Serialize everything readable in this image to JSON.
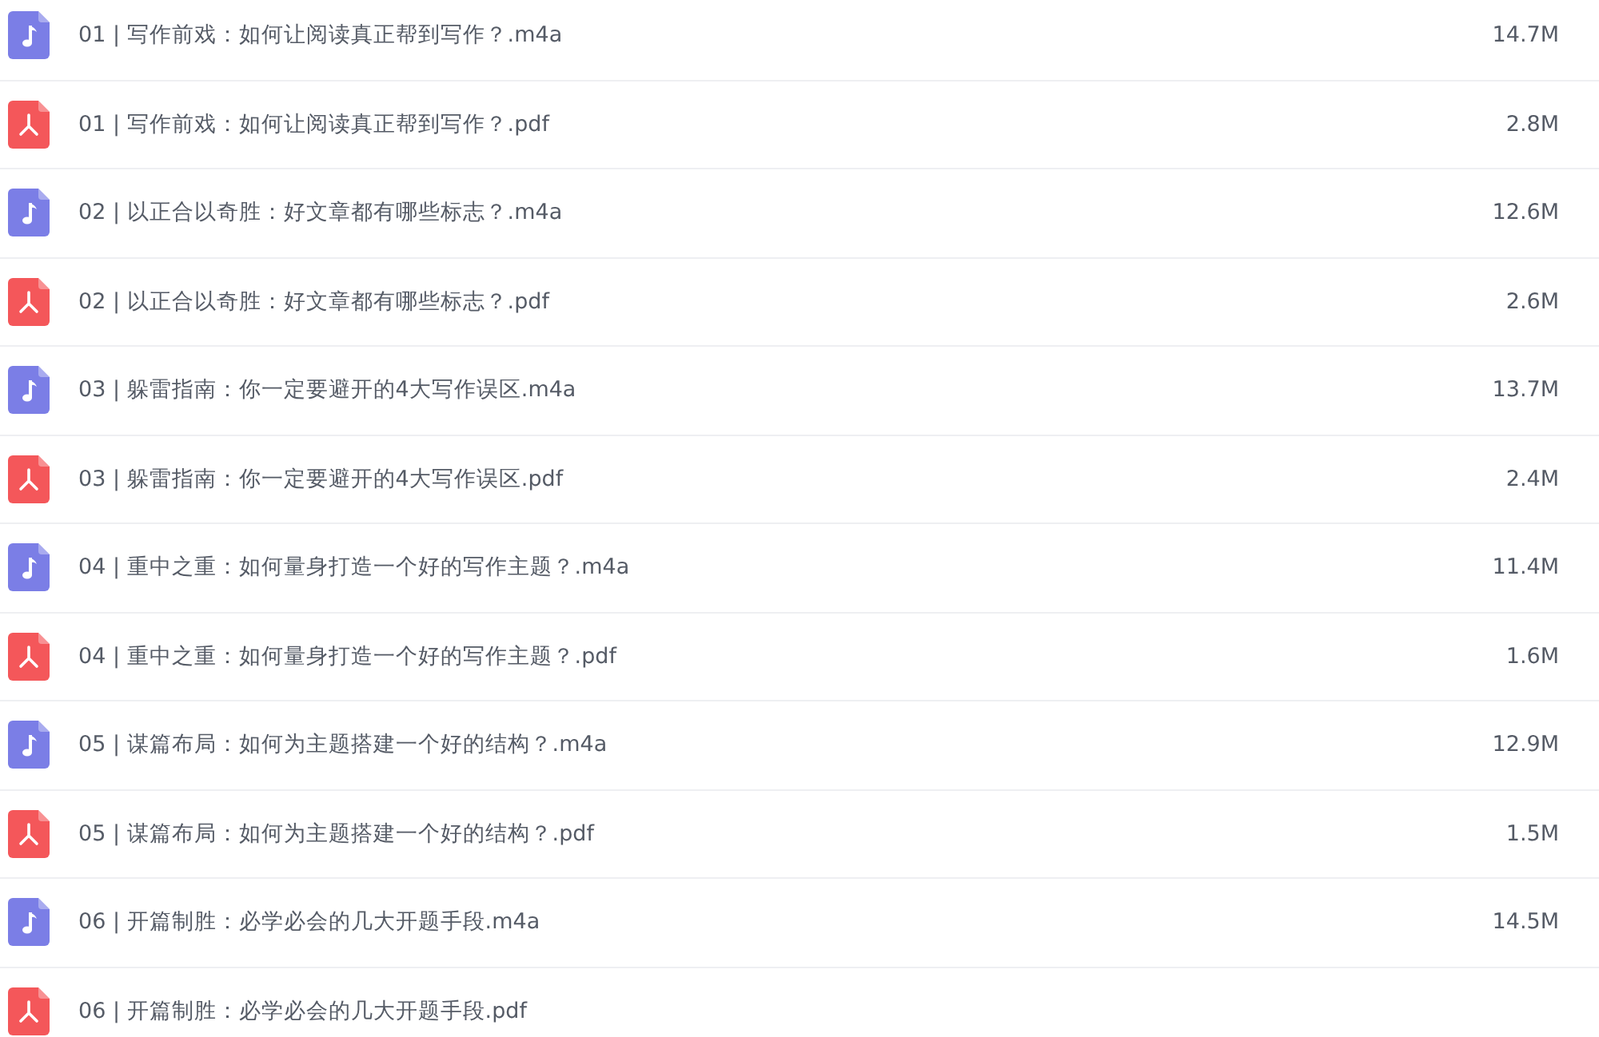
{
  "files": [
    {
      "kind": "audio",
      "name": "01 | 写作前戏：如何让阅读真正帮到写作？.m4a",
      "size": "14.7M"
    },
    {
      "kind": "pdf",
      "name": "01 | 写作前戏：如何让阅读真正帮到写作？.pdf",
      "size": "2.8M"
    },
    {
      "kind": "audio",
      "name": "02 | 以正合以奇胜：好文章都有哪些标志？.m4a",
      "size": "12.6M"
    },
    {
      "kind": "pdf",
      "name": "02 | 以正合以奇胜：好文章都有哪些标志？.pdf",
      "size": "2.6M"
    },
    {
      "kind": "audio",
      "name": "03 | 躲雷指南：你一定要避开的4大写作误区.m4a",
      "size": "13.7M"
    },
    {
      "kind": "pdf",
      "name": "03 | 躲雷指南：你一定要避开的4大写作误区.pdf",
      "size": "2.4M"
    },
    {
      "kind": "audio",
      "name": "04 | 重中之重：如何量身打造一个好的写作主题？.m4a",
      "size": "11.4M"
    },
    {
      "kind": "pdf",
      "name": "04 | 重中之重：如何量身打造一个好的写作主题？.pdf",
      "size": "1.6M"
    },
    {
      "kind": "audio",
      "name": "05 | 谋篇布局：如何为主题搭建一个好的结构？.m4a",
      "size": "12.9M"
    },
    {
      "kind": "pdf",
      "name": "05 | 谋篇布局：如何为主题搭建一个好的结构？.pdf",
      "size": "1.5M"
    },
    {
      "kind": "audio",
      "name": "06 | 开篇制胜：必学必会的几大开题手段.m4a",
      "size": "14.5M"
    },
    {
      "kind": "pdf",
      "name": "06 | 开篇制胜：必学必会的几大开题手段.pdf"
    }
  ]
}
